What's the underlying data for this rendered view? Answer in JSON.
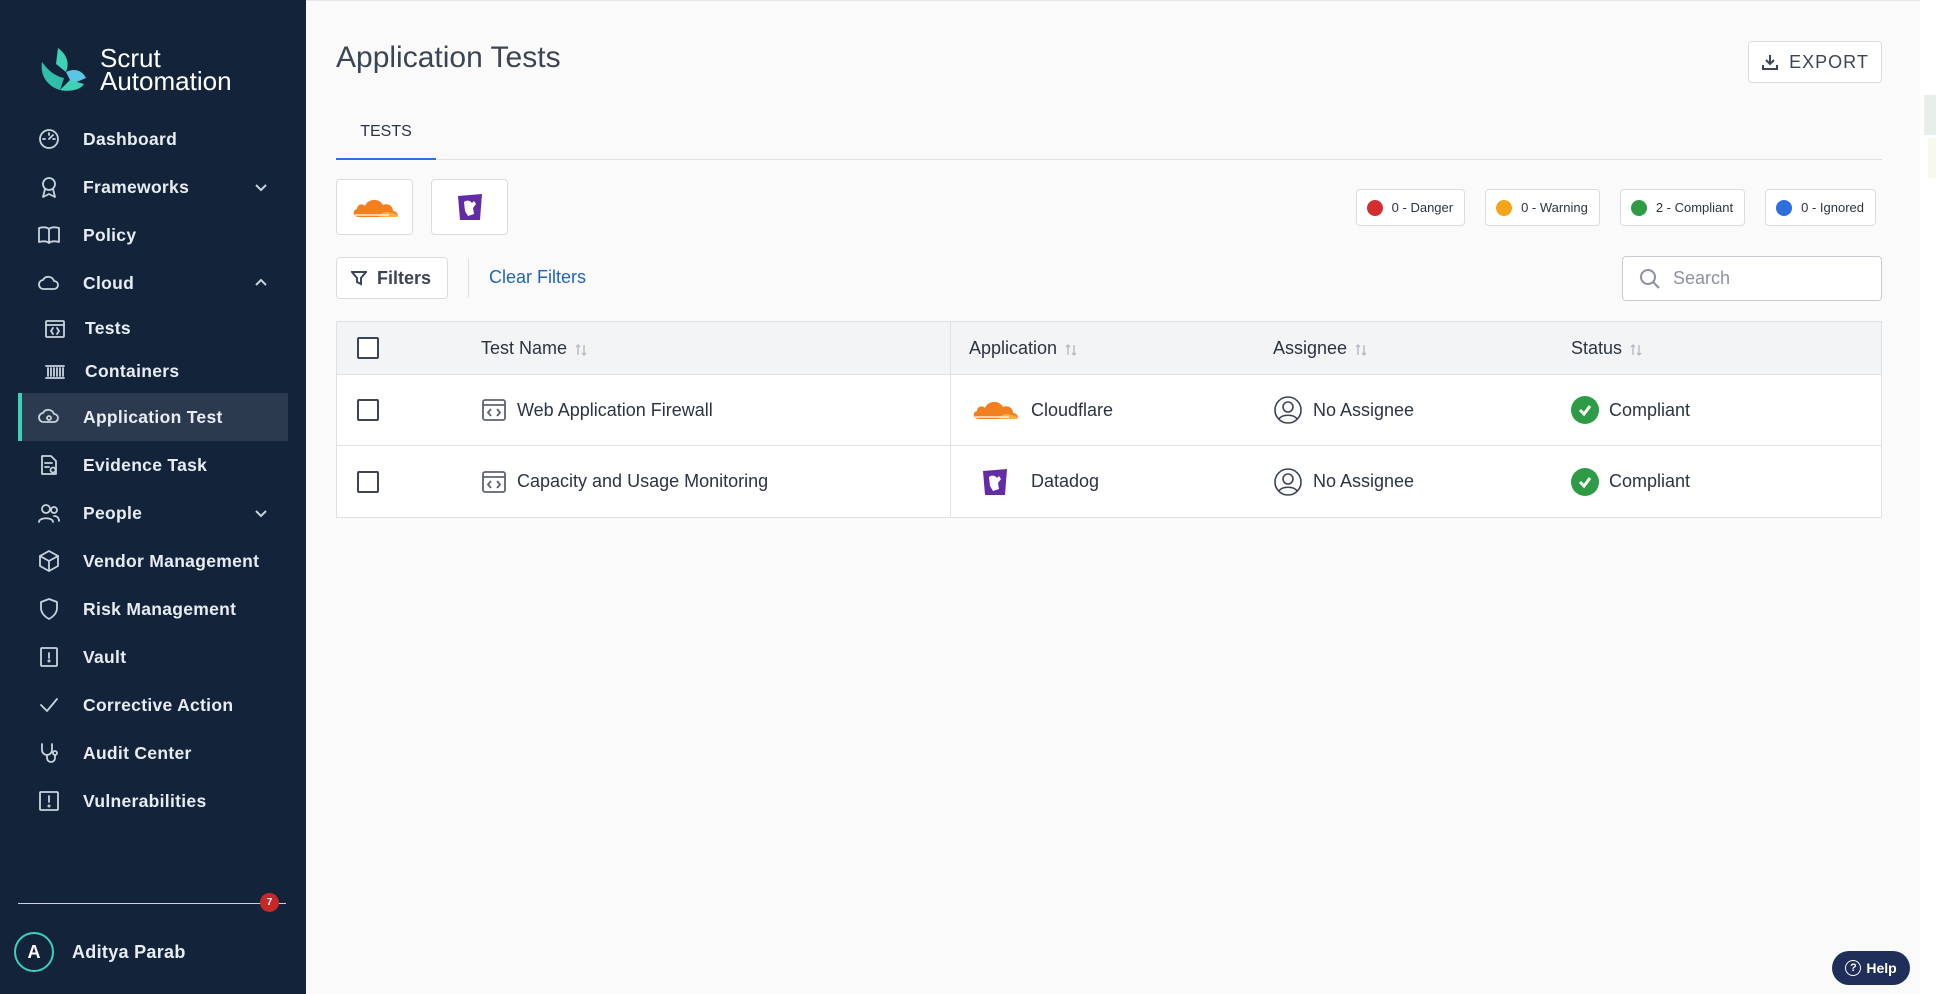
{
  "brand": {
    "line1": "Scrut",
    "line2": "Automation"
  },
  "sidebar": {
    "items": [
      {
        "label": "Dashboard",
        "icon": "dashboard-icon"
      },
      {
        "label": "Frameworks",
        "icon": "award-icon",
        "chevron": "down"
      },
      {
        "label": "Policy",
        "icon": "book-icon"
      },
      {
        "label": "Cloud",
        "icon": "cloud-icon",
        "chevron": "up"
      },
      {
        "label": "Tests",
        "icon": "code-icon",
        "sub": true
      },
      {
        "label": "Containers",
        "icon": "containers-icon",
        "sub": true
      },
      {
        "label": "Application Test",
        "icon": "app-cloud-icon",
        "active": true
      },
      {
        "label": "Evidence Task",
        "icon": "evidence-icon"
      },
      {
        "label": "People",
        "icon": "people-icon",
        "chevron": "down"
      },
      {
        "label": "Vendor Management",
        "icon": "box-icon"
      },
      {
        "label": "Risk Management",
        "icon": "shield-icon"
      },
      {
        "label": "Vault",
        "icon": "vault-icon"
      },
      {
        "label": "Corrective Action",
        "icon": "check-icon"
      },
      {
        "label": "Audit Center",
        "icon": "stethoscope-icon"
      },
      {
        "label": "Vulnerabilities",
        "icon": "alert-icon"
      }
    ],
    "notification_count": "7",
    "user": {
      "initial": "A",
      "name": "Aditya Parab"
    }
  },
  "header": {
    "title": "Application Tests",
    "export_label": "EXPORT"
  },
  "tabs": [
    {
      "label": "TESTS",
      "active": true
    }
  ],
  "app_filters": [
    {
      "name": "Cloudflare"
    },
    {
      "name": "Datadog"
    }
  ],
  "status_chips": [
    {
      "label": "0 - Danger",
      "color": "#d32f2f"
    },
    {
      "label": "0 - Warning",
      "color": "#f2a51a"
    },
    {
      "label": "2 - Compliant",
      "color": "#2e9b46"
    },
    {
      "label": "0 - Ignored",
      "color": "#2d6fdb"
    }
  ],
  "filters": {
    "button_label": "Filters",
    "clear_label": "Clear Filters"
  },
  "search": {
    "placeholder": "Search",
    "value": ""
  },
  "table": {
    "columns": [
      "Test Name",
      "Application",
      "Assignee",
      "Status"
    ],
    "rows": [
      {
        "test_name": "Web Application Firewall",
        "application": "Cloudflare",
        "assignee": "No Assignee",
        "status": "Compliant"
      },
      {
        "test_name": "Capacity and Usage Monitoring",
        "application": "Datadog",
        "assignee": "No Assignee",
        "status": "Compliant"
      }
    ]
  },
  "help": {
    "label": "Help"
  },
  "colors": {
    "sidebar_bg": "#13243a",
    "accent": "#3fd1b5",
    "link": "#2364b8",
    "compliant": "#2e9b46"
  }
}
